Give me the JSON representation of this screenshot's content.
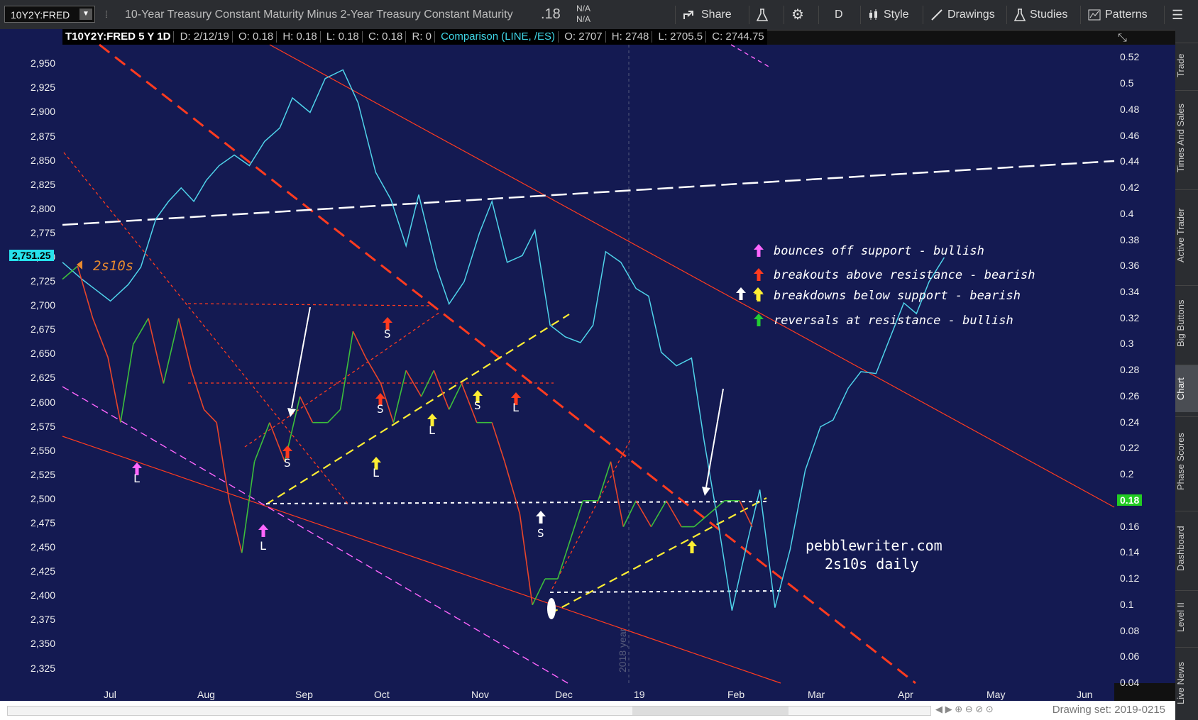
{
  "toolbar": {
    "symbol": "10Y2Y:FRED",
    "study_title": "10-Year Treasury Constant Maturity Minus 2-Year Treasury Constant Maturity",
    "last_value": ".18",
    "na1": "N/A",
    "na2": "N/A",
    "share": "Share",
    "period": "D",
    "style": "Style",
    "drawings": "Drawings",
    "studies": "Studies",
    "patterns": "Patterns"
  },
  "infobar": {
    "symbol": "T10Y2Y:FRED 5 Y 1D",
    "date": "D: 2/12/19",
    "open": "O: 0.18",
    "high": "H: 0.18",
    "low": "L: 0.18",
    "close": "C: 0.18",
    "r": "R: 0",
    "comparison": "Comparison (LINE, /ES)",
    "cmp_open": "O: 2707",
    "cmp_high": "H: 2748",
    "cmp_low": "L: 2705.5",
    "cmp_close": "C: 2744.75"
  },
  "side_tabs": [
    "Trade",
    "Times And Sales",
    "Active Trader",
    "Big Buttons",
    "Chart",
    "Phase Scores",
    "Dashboard",
    "Level II",
    "Live News"
  ],
  "bottom": {
    "drawing_set": "Drawing set: 2019-0215"
  },
  "colors": {
    "background": "#141a52",
    "es_line": "#4fd3ea",
    "spread_up": "#3cbf3c",
    "spread_down": "#e8452a",
    "support": "#ffee33",
    "resistance": "#ff3b1f",
    "pink": "#ff66ff"
  },
  "chart_data": {
    "type": "line",
    "x_ticks": [
      "Jul",
      "Aug",
      "Sep",
      "Oct",
      "Nov",
      "Dec",
      "19",
      "Feb",
      "Mar",
      "Apr",
      "May",
      "Jun"
    ],
    "left_axis_ticks": [
      "2,950",
      "2,925",
      "2,900",
      "2,875",
      "2,850",
      "2,825",
      "2,800",
      "2,775",
      "2,750",
      "2,725",
      "2,700",
      "2,675",
      "2,650",
      "2,625",
      "2,600",
      "2,575",
      "2,550",
      "2,525",
      "2,500",
      "2,475",
      "2,450",
      "2,425",
      "2,400",
      "2,375",
      "2,350",
      "2,325"
    ],
    "right_axis_ticks": [
      "0.52",
      "0.5",
      "0.48",
      "0.46",
      "0.44",
      "0.42",
      "0.4",
      "0.38",
      "0.36",
      "0.34",
      "0.32",
      "0.3",
      "0.28",
      "0.26",
      "0.24",
      "0.22",
      "0.2",
      "0.18",
      "0.16",
      "0.14",
      "0.12",
      "0.1",
      "0.08",
      "0.06",
      "0.04"
    ],
    "left_ylim": [
      2310,
      2970
    ],
    "right_ylim": [
      0.04,
      0.53
    ],
    "current_es_label": "2,751.25",
    "current_spread_label": "0.18",
    "year_marker": "2018 year",
    "series_label": "2s10s",
    "series": [
      {
        "name": "/ES",
        "color": "#4fd3ea",
        "points": [
          [
            0,
            2745
          ],
          [
            8,
            2727
          ],
          [
            14,
            2715
          ],
          [
            19,
            2705
          ],
          [
            26,
            2722
          ],
          [
            31,
            2740
          ],
          [
            37,
            2790
          ],
          [
            42,
            2808
          ],
          [
            47,
            2822
          ],
          [
            52,
            2808
          ],
          [
            57,
            2830
          ],
          [
            62,
            2845
          ],
          [
            68,
            2856
          ],
          [
            74,
            2845
          ],
          [
            80,
            2870
          ],
          [
            86,
            2884
          ],
          [
            91,
            2915
          ],
          [
            98,
            2900
          ],
          [
            104,
            2935
          ],
          [
            111,
            2944
          ],
          [
            117,
            2910
          ],
          [
            124,
            2838
          ],
          [
            130,
            2810
          ],
          [
            136,
            2762
          ],
          [
            141,
            2815
          ],
          [
            148,
            2740
          ],
          [
            153,
            2702
          ],
          [
            159,
            2725
          ],
          [
            165,
            2775
          ],
          [
            170,
            2808
          ],
          [
            176,
            2745
          ],
          [
            182,
            2752
          ],
          [
            187,
            2778
          ],
          [
            193,
            2680
          ],
          [
            199,
            2668
          ],
          [
            205,
            2662
          ],
          [
            210,
            2680
          ],
          [
            215,
            2756
          ],
          [
            221,
            2745
          ],
          [
            227,
            2718
          ],
          [
            232,
            2710
          ],
          [
            237,
            2652
          ],
          [
            243,
            2638
          ],
          [
            249,
            2646
          ],
          [
            254,
            2560
          ],
          [
            260,
            2468
          ],
          [
            265,
            2385
          ],
          [
            271,
            2455
          ],
          [
            276,
            2510
          ],
          [
            282,
            2388
          ],
          [
            288,
            2448
          ],
          [
            294,
            2530
          ],
          [
            300,
            2575
          ],
          [
            305,
            2582
          ],
          [
            311,
            2615
          ],
          [
            316,
            2632
          ],
          [
            322,
            2630
          ],
          [
            328,
            2670
          ],
          [
            333,
            2703
          ],
          [
            338,
            2692
          ],
          [
            343,
            2725
          ],
          [
            349,
            2750
          ]
        ]
      },
      {
        "name": "2s10s",
        "points": [
          [
            0,
            0.35
          ],
          [
            6,
            0.36
          ],
          [
            12,
            0.32
          ],
          [
            18,
            0.29
          ],
          [
            23,
            0.24
          ],
          [
            28,
            0.3
          ],
          [
            34,
            0.32
          ],
          [
            40,
            0.27
          ],
          [
            46,
            0.32
          ],
          [
            51,
            0.28
          ],
          [
            56,
            0.25
          ],
          [
            61,
            0.24
          ],
          [
            66,
            0.18
          ],
          [
            71,
            0.14
          ],
          [
            76,
            0.21
          ],
          [
            82,
            0.24
          ],
          [
            88,
            0.21
          ],
          [
            94,
            0.26
          ],
          [
            99,
            0.24
          ],
          [
            105,
            0.24
          ],
          [
            110,
            0.25
          ],
          [
            115,
            0.31
          ],
          [
            120,
            0.29
          ],
          [
            126,
            0.27
          ],
          [
            131,
            0.24
          ],
          [
            136,
            0.28
          ],
          [
            142,
            0.26
          ],
          [
            147,
            0.28
          ],
          [
            153,
            0.25
          ],
          [
            158,
            0.27
          ],
          [
            164,
            0.24
          ],
          [
            170,
            0.24
          ],
          [
            175,
            0.21
          ],
          [
            181,
            0.17
          ],
          [
            186,
            0.1
          ],
          [
            191,
            0.12
          ],
          [
            196,
            0.12
          ],
          [
            201,
            0.15
          ],
          [
            206,
            0.18
          ],
          [
            212,
            0.18
          ],
          [
            217,
            0.21
          ],
          [
            222,
            0.16
          ],
          [
            227,
            0.18
          ],
          [
            233,
            0.16
          ],
          [
            239,
            0.18
          ],
          [
            245,
            0.16
          ],
          [
            250,
            0.16
          ],
          [
            256,
            0.17
          ],
          [
            262,
            0.18
          ],
          [
            268,
            0.18
          ],
          [
            273,
            0.16
          ]
        ]
      }
    ],
    "annotations": {
      "arrow_labels": [
        "L",
        "L",
        "S",
        "S",
        "L",
        "S",
        "S",
        "L",
        "L",
        "S"
      ],
      "legend": [
        {
          "color": "#ff66ff",
          "text": "bounces off support - bullish"
        },
        {
          "color": "#ff3b1f",
          "text": "breakouts above resistance - bearish"
        },
        {
          "color": "#ffee33",
          "text": "breakdowns below support - bearish"
        },
        {
          "color": "#22cc33",
          "text": "reversals at resistance - bullish"
        }
      ],
      "watermark": [
        "pebblewriter.com",
        "2s10s daily"
      ]
    }
  }
}
